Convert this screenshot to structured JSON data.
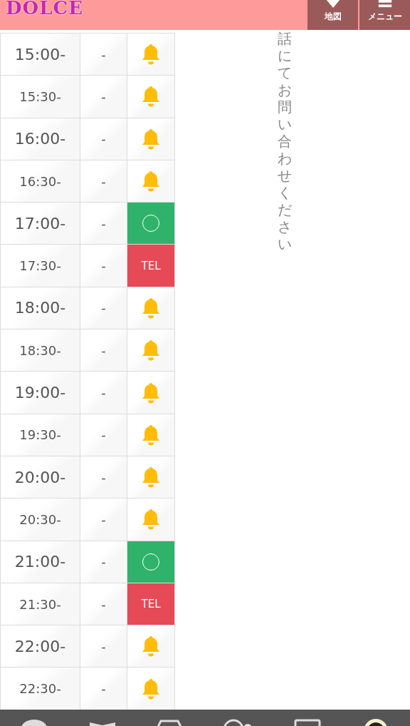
{
  "header": {
    "logo": "DOLCE",
    "buttons": [
      {
        "kind": "map",
        "label": "地図"
      },
      {
        "kind": "menu",
        "label": "メニュー"
      }
    ]
  },
  "schedule": [
    {
      "time": "15:00-",
      "emphasis": true,
      "col_2": "-",
      "kind": "bell"
    },
    {
      "time": "15:30-",
      "emphasis": false,
      "col_2": "-",
      "kind": "bell"
    },
    {
      "time": "16:00-",
      "emphasis": true,
      "col_2": "-",
      "kind": "bell"
    },
    {
      "time": "16:30-",
      "emphasis": false,
      "col_2": "-",
      "kind": "bell"
    },
    {
      "time": "17:00-",
      "emphasis": true,
      "col_2": "-",
      "kind": "open"
    },
    {
      "time": "17:30-",
      "emphasis": false,
      "col_2": "-",
      "kind": "tel",
      "label": "TEL"
    },
    {
      "time": "18:00-",
      "emphasis": true,
      "col_2": "-",
      "kind": "bell"
    },
    {
      "time": "18:30-",
      "emphasis": false,
      "col_2": "-",
      "kind": "bell"
    },
    {
      "time": "19:00-",
      "emphasis": true,
      "col_2": "-",
      "kind": "bell"
    },
    {
      "time": "19:30-",
      "emphasis": false,
      "col_2": "-",
      "kind": "bell"
    },
    {
      "time": "20:00-",
      "emphasis": true,
      "col_2": "-",
      "kind": "bell"
    },
    {
      "time": "20:30-",
      "emphasis": false,
      "col_2": "-",
      "kind": "bell"
    },
    {
      "time": "21:00-",
      "emphasis": true,
      "col_2": "-",
      "kind": "open"
    },
    {
      "time": "21:30-",
      "emphasis": false,
      "col_2": "-",
      "kind": "tel",
      "label": "TEL"
    },
    {
      "time": "22:00-",
      "emphasis": true,
      "col_2": "-",
      "kind": "bell"
    },
    {
      "time": "22:30-",
      "emphasis": false,
      "col_2": "-",
      "kind": "bell"
    }
  ],
  "note": "話にてお問い合わせください"
}
